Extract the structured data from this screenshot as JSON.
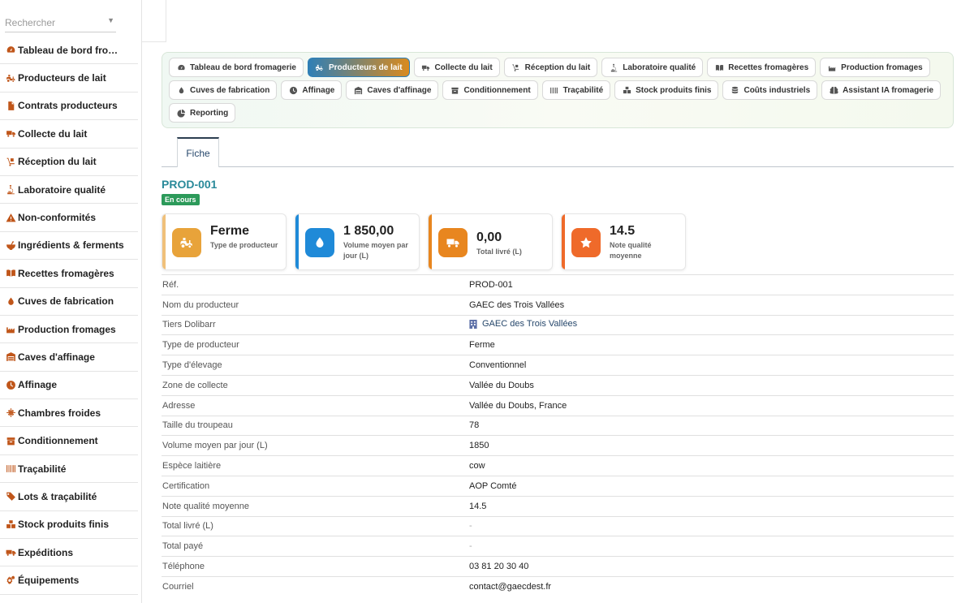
{
  "search": {
    "placeholder": "Rechercher"
  },
  "sidebar": {
    "items": [
      {
        "label": "Tableau de bord fro…",
        "icon": "dashboard-icon"
      },
      {
        "label": "Producteurs de lait",
        "icon": "tractor-icon"
      },
      {
        "label": "Contrats producteurs",
        "icon": "contract-icon"
      },
      {
        "label": "Collecte du lait",
        "icon": "truck-icon"
      },
      {
        "label": "Réception du lait",
        "icon": "dolly-icon"
      },
      {
        "label": "Laboratoire qualité",
        "icon": "microscope-icon"
      },
      {
        "label": "Non-conformités",
        "icon": "warning-icon"
      },
      {
        "label": "Ingrédients & ferments",
        "icon": "mortar-icon"
      },
      {
        "label": "Recettes fromagères",
        "icon": "book-icon"
      },
      {
        "label": "Cuves de fabrication",
        "icon": "drop-icon"
      },
      {
        "label": "Production fromages",
        "icon": "factory-icon"
      },
      {
        "label": "Caves d'affinage",
        "icon": "warehouse-icon"
      },
      {
        "label": "Affinage",
        "icon": "clock-icon"
      },
      {
        "label": "Chambres froides",
        "icon": "snowflake-icon"
      },
      {
        "label": "Conditionnement",
        "icon": "box-icon"
      },
      {
        "label": "Traçabilité",
        "icon": "barcode-icon"
      },
      {
        "label": "Lots & traçabilité",
        "icon": "tags-icon"
      },
      {
        "label": "Stock produits finis",
        "icon": "boxes-icon"
      },
      {
        "label": "Expéditions",
        "icon": "shipping-icon"
      },
      {
        "label": "Équipements",
        "icon": "cogs-icon"
      }
    ]
  },
  "nav": {
    "rows": [
      [
        {
          "label": "Tableau de bord fromagerie",
          "icon": "dashboard-icon",
          "active": false
        },
        {
          "label": "Producteurs de lait",
          "icon": "tractor-icon",
          "active": true
        },
        {
          "label": "Collecte du lait",
          "icon": "truck-icon",
          "active": false
        },
        {
          "label": "Réception du lait",
          "icon": "dolly-icon",
          "active": false
        },
        {
          "label": "Laboratoire qualité",
          "icon": "microscope-icon",
          "active": false
        },
        {
          "label": "Recettes fromagères",
          "icon": "book-icon",
          "active": false
        },
        {
          "label": "Production fromages",
          "icon": "factory-icon",
          "active": false
        }
      ],
      [
        {
          "label": "Cuves de fabrication",
          "icon": "drop-icon",
          "active": false
        },
        {
          "label": "Affinage",
          "icon": "clock-icon",
          "active": false
        },
        {
          "label": "Caves d'affinage",
          "icon": "warehouse-icon",
          "active": false
        },
        {
          "label": "Conditionnement",
          "icon": "box-icon",
          "active": false
        },
        {
          "label": "Traçabilité",
          "icon": "barcode-icon",
          "active": false
        },
        {
          "label": "Stock produits finis",
          "icon": "boxes-icon",
          "active": false
        },
        {
          "label": "Coûts industriels",
          "icon": "coins-icon",
          "active": false
        },
        {
          "label": "Assistant IA fromagerie",
          "icon": "brain-icon",
          "active": false
        }
      ],
      [
        {
          "label": "Reporting",
          "icon": "chart-pie-icon",
          "active": false
        }
      ]
    ]
  },
  "tabs": {
    "fiche": "Fiche"
  },
  "record": {
    "ref": "PROD-001",
    "status": "En cours"
  },
  "cards": [
    {
      "value": "Ferme",
      "label": "Type de producteur",
      "icon": "tractor-icon",
      "color": "#e8a33a",
      "bar": "#f0c07a"
    },
    {
      "value": "1 850,00",
      "label": "Volume moyen par jour (L)",
      "icon": "drop-icon",
      "color": "#1f8ad8",
      "bar": "#1f8ad8"
    },
    {
      "value": "0,00",
      "label": "Total livré (L)",
      "icon": "truck-icon",
      "color": "#e8861f",
      "bar": "#e8861f"
    },
    {
      "value": "14.5",
      "label": "Note qualité moyenne",
      "icon": "star-icon",
      "color": "#ef6a2a",
      "bar": "#ef6a2a"
    }
  ],
  "fields": {
    "ref": {
      "label": "Réf.",
      "value": "PROD-001"
    },
    "name": {
      "label": "Nom du producteur",
      "value": "GAEC des Trois Vallées"
    },
    "tiers": {
      "label": "Tiers Dolibarr",
      "value": "GAEC des Trois Vallées"
    },
    "type": {
      "label": "Type de producteur",
      "value": "Ferme"
    },
    "breeding": {
      "label": "Type d'élevage",
      "value": "Conventionnel"
    },
    "zone": {
      "label": "Zone de collecte",
      "value": "Vallée du Doubs"
    },
    "address": {
      "label": "Adresse",
      "value": "Vallée du Doubs, France"
    },
    "herd": {
      "label": "Taille du troupeau",
      "value": "78"
    },
    "volume": {
      "label": "Volume moyen par jour (L)",
      "value": "1850"
    },
    "species": {
      "label": "Espèce laitière",
      "value": "cow"
    },
    "certification": {
      "label": "Certification",
      "value": "AOP Comté"
    },
    "quality": {
      "label": "Note qualité moyenne",
      "value": "14.5"
    },
    "delivered": {
      "label": "Total livré (L)",
      "value": "-"
    },
    "paid": {
      "label": "Total payé",
      "value": "-"
    },
    "phone": {
      "label": "Téléphone",
      "value": "03 81 20 30 40"
    },
    "email": {
      "label": "Courriel",
      "value": "contact@gaecdest.fr"
    }
  },
  "colors": {
    "accent_teal": "#2a8a9a",
    "status_green": "#2c9a5a",
    "sidebar_icon": "#c0561a",
    "link": "#26476b"
  }
}
